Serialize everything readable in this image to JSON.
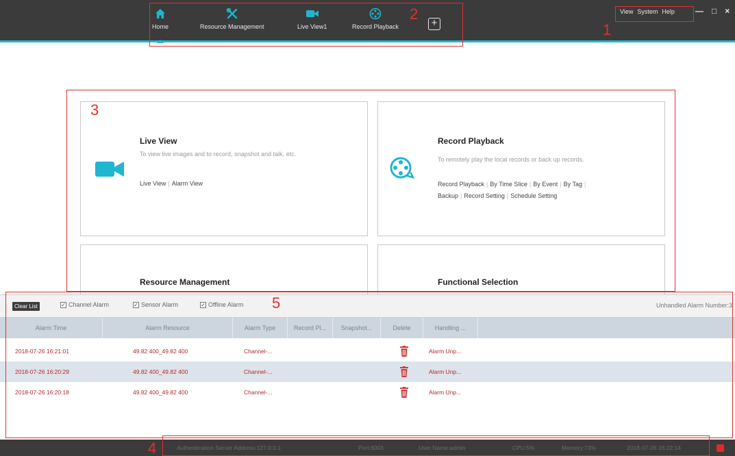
{
  "nav": {
    "items": [
      {
        "label": "Home",
        "icon": "home-icon"
      },
      {
        "label": "Resource Management",
        "icon": "tools-icon"
      },
      {
        "label": "Live View1",
        "icon": "camera-icon"
      },
      {
        "label": "Record Playback",
        "icon": "film-reel-icon"
      }
    ],
    "add_label": "+"
  },
  "system_menu": {
    "view": "View",
    "system": "System",
    "help": "Help"
  },
  "window_controls": {
    "minimize": "—",
    "maximize": "□",
    "close": "×"
  },
  "annotations": [
    "1",
    "2",
    "3",
    "4",
    "5"
  ],
  "cards": {
    "live_view": {
      "title": "Live View",
      "desc": "To view live images and to record, snapshot and talk, etc.",
      "links": [
        "Live View",
        "Alarm View"
      ]
    },
    "record_playback": {
      "title": "Record Playback",
      "desc": "To remotely play the local records or back up records.",
      "links": [
        "Record Playback",
        "By Time Slice",
        "By Event",
        "By Tag",
        "Backup",
        "Record Setting",
        "Schedule Setting"
      ]
    },
    "resource_management": {
      "title": "Resource Management"
    },
    "functional_selection": {
      "title": "Functional Selection"
    }
  },
  "alarm_panel": {
    "clear_label": "Clear List",
    "filters": [
      {
        "label": "Channel Alarm",
        "checked": true
      },
      {
        "label": "Sensor Alarm",
        "checked": true
      },
      {
        "label": "Offline Alarm",
        "checked": true
      }
    ],
    "unhandled_label": "Unhandled Alarm Number:3",
    "columns": [
      "Alarm Time",
      "Alarm Resource",
      "Alarm Type",
      "Record Pl...",
      "Snapshot...",
      "Delete",
      "Handling ..."
    ],
    "rows": [
      {
        "time": "2018-07-26 16:21:01",
        "resource": "49.82 400_49.82 400",
        "type": "Channel-...",
        "handling": "Alarm Unp..."
      },
      {
        "time": "2018-07-26 16:20:29",
        "resource": "49.82 400_49.82 400",
        "type": "Channel-...",
        "handling": "Alarm Unp..."
      },
      {
        "time": "2018-07-26 16:20:18",
        "resource": "49.82 400_49.82 400",
        "type": "Channel-...",
        "handling": "Alarm Unp..."
      }
    ]
  },
  "status_bar": {
    "auth": "Authentication Server Address:127.0.0.1",
    "port": "Port:6003",
    "user": "User Name:admin",
    "cpu": "CPU:5%",
    "memory": "Memory:73%",
    "datetime": "2018-07-26 16:22:14"
  },
  "colors": {
    "accent": "#1fb6d0",
    "topbar": "#3b3b3b",
    "alarm_text": "#b02a2a",
    "annotation": "#e03030"
  }
}
